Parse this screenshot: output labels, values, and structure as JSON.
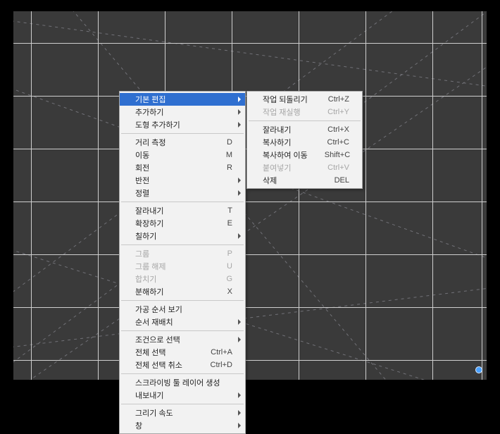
{
  "grid": {
    "h_positions": [
      45,
      120,
      195,
      270,
      345,
      420,
      495
    ],
    "v_positions": [
      25,
      120,
      215,
      310,
      405,
      500,
      595,
      665
    ]
  },
  "main_menu": {
    "groups": [
      [
        {
          "label": "기본 편집",
          "submenu": true,
          "highlight": true
        },
        {
          "label": "추가하기",
          "submenu": true
        },
        {
          "label": "도형 추가하기",
          "submenu": true
        }
      ],
      [
        {
          "label": "거리 측정",
          "shortcut": "D"
        },
        {
          "label": "이동",
          "shortcut": "M"
        },
        {
          "label": "회전",
          "shortcut": "R"
        },
        {
          "label": "반전",
          "submenu": true
        },
        {
          "label": "정렬",
          "submenu": true
        }
      ],
      [
        {
          "label": "잘라내기",
          "shortcut": "T"
        },
        {
          "label": "확장하기",
          "shortcut": "E"
        },
        {
          "label": "칠하기",
          "submenu": true
        }
      ],
      [
        {
          "label": "그룹",
          "shortcut": "P",
          "disabled": true
        },
        {
          "label": "그룹 해제",
          "shortcut": "U",
          "disabled": true
        },
        {
          "label": "합치기",
          "shortcut": "G",
          "disabled": true
        },
        {
          "label": "분해하기",
          "shortcut": "X"
        }
      ],
      [
        {
          "label": "가공 순서 보기"
        },
        {
          "label": "순서 재배치",
          "submenu": true
        }
      ],
      [
        {
          "label": "조건으로 선택",
          "submenu": true
        },
        {
          "label": "전체 선택",
          "shortcut": "Ctrl+A"
        },
        {
          "label": "전체 선택 취소",
          "shortcut": "Ctrl+D"
        }
      ],
      [
        {
          "label": "스크라이빙 툴 레이어 생성"
        },
        {
          "label": "내보내기",
          "submenu": true
        }
      ],
      [
        {
          "label": "그리기 속도",
          "submenu": true
        },
        {
          "label": "창",
          "submenu": true
        }
      ]
    ]
  },
  "sub_menu": {
    "groups": [
      [
        {
          "label": "작업 되돌리기",
          "shortcut": "Ctrl+Z"
        },
        {
          "label": "작업 재실행",
          "shortcut": "Ctrl+Y",
          "disabled": true
        }
      ],
      [
        {
          "label": "잘라내기",
          "shortcut": "Ctrl+X"
        },
        {
          "label": "복사하기",
          "shortcut": "Ctrl+C"
        },
        {
          "label": "복사하여 이동",
          "shortcut": "Shift+C"
        },
        {
          "label": "붙여넣기",
          "shortcut": "Ctrl+V",
          "disabled": true
        },
        {
          "label": "삭제",
          "shortcut": "DEL"
        }
      ]
    ]
  }
}
